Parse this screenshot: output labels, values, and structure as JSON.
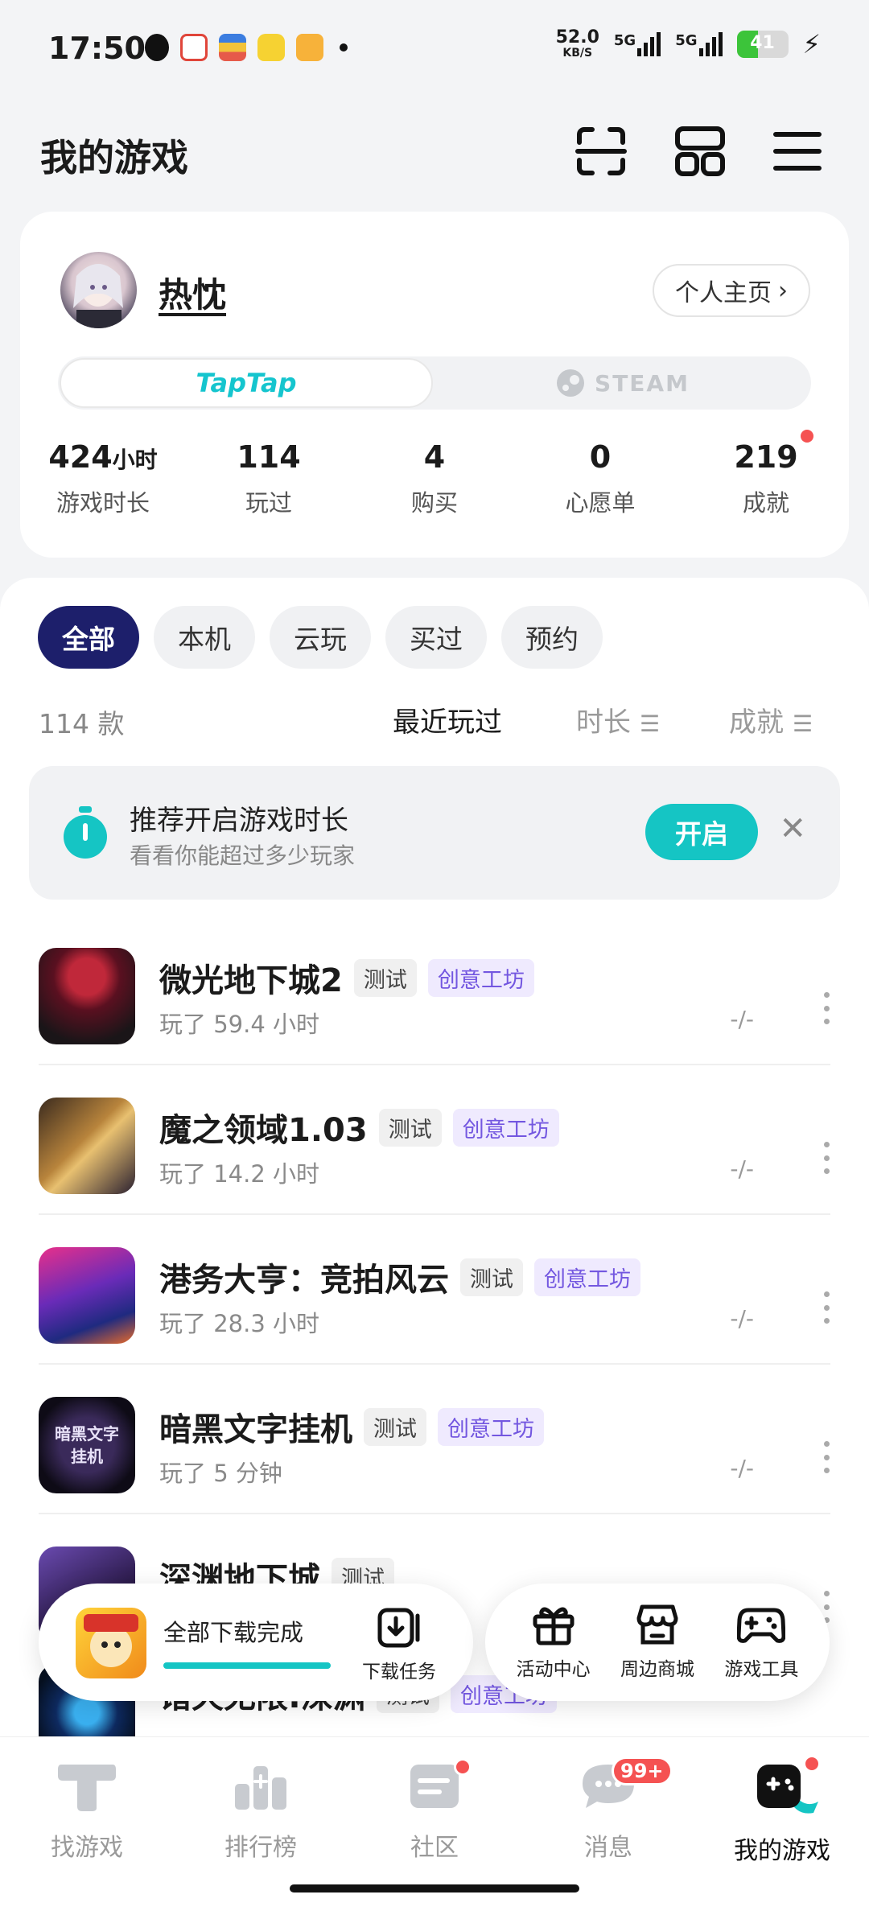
{
  "status_bar": {
    "time": "17:50",
    "speed_value": "52.0",
    "speed_unit": "KB/S",
    "signal1": "5G",
    "signal2": "5G",
    "battery": "41",
    "battery_level": 0.41
  },
  "header": {
    "title": "我的游戏",
    "icons": [
      "scan-icon",
      "grid-icon",
      "menu-icon"
    ]
  },
  "profile": {
    "username": "热忱",
    "homepage_label": "个人主页",
    "platforms": {
      "taptap": "TapTap",
      "steam": "STEAM"
    },
    "stats": [
      {
        "value": "424",
        "unit": "小时",
        "label": "游戏时长"
      },
      {
        "value": "114",
        "unit": "",
        "label": "玩过"
      },
      {
        "value": "4",
        "unit": "",
        "label": "购买"
      },
      {
        "value": "0",
        "unit": "",
        "label": "心愿单"
      },
      {
        "value": "219",
        "unit": "",
        "label": "成就"
      }
    ]
  },
  "filters": {
    "tabs": [
      "全部",
      "本机",
      "云玩",
      "买过",
      "预约"
    ],
    "active": "全部",
    "count": "114 款",
    "sort_recent": "最近玩过",
    "sort_duration": "时长",
    "sort_achievement": "成就"
  },
  "recommend": {
    "title": "推荐开启游戏时长",
    "subtitle": "看看你能超过多少玩家",
    "button": "开启"
  },
  "tags": {
    "test": "测试",
    "workshop": "创意工坊"
  },
  "games": [
    {
      "name": "微光地下城2",
      "played": "玩了 59.4 小时",
      "score": "-/-",
      "workshop": true
    },
    {
      "name": "魔之领域1.03",
      "played": "玩了 14.2 小时",
      "score": "-/-",
      "workshop": true
    },
    {
      "name": "港务大亨：竞拍风云",
      "played": "玩了 28.3 小时",
      "score": "-/-",
      "workshop": true
    },
    {
      "name": "暗黑文字挂机",
      "played": "玩了 5 分钟",
      "score": "-/-",
      "workshop": true,
      "thumb_text": "暗黑文字挂机"
    },
    {
      "name": "深渊地下城",
      "played": "",
      "score": "",
      "workshop": false
    },
    {
      "name": "诸天无限:深渊",
      "played": "",
      "score": "",
      "workshop": true
    }
  ],
  "download": {
    "status": "全部下载完成",
    "progress": 1.0,
    "task_label": "下载任务"
  },
  "tools": [
    {
      "label": "活动中心",
      "icon": "gift-icon"
    },
    {
      "label": "周边商城",
      "icon": "shop-icon"
    },
    {
      "label": "游戏工具",
      "icon": "gamepad-icon"
    }
  ],
  "bottom_nav": [
    {
      "label": "找游戏",
      "icon": "taptap-logo-icon"
    },
    {
      "label": "排行榜",
      "icon": "ranking-icon"
    },
    {
      "label": "社区",
      "icon": "community-icon"
    },
    {
      "label": "消息",
      "icon": "message-icon",
      "badge": "99+"
    },
    {
      "label": "我的游戏",
      "icon": "my-games-icon",
      "active": true
    }
  ],
  "colors": {
    "accent": "#15c5c4",
    "active_chip": "#1d1f6b",
    "badge_red": "#f55252",
    "workshop_text": "#7357e0"
  }
}
